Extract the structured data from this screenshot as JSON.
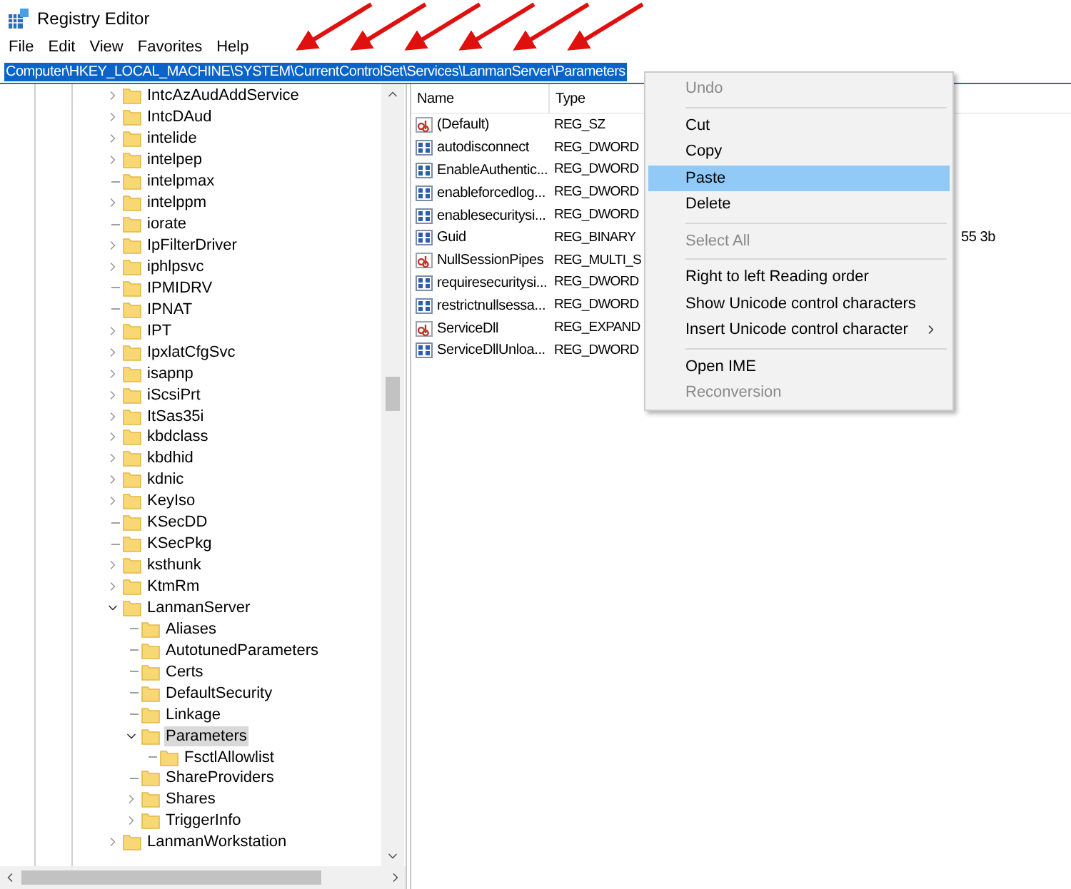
{
  "window": {
    "title": "Registry Editor"
  },
  "menu": [
    "File",
    "Edit",
    "View",
    "Favorites",
    "Help"
  ],
  "address": {
    "value": "Computer\\HKEY_LOCAL_MACHINE\\SYSTEM\\CurrentControlSet\\Services\\LanmanServer\\Parameters",
    "selected": true
  },
  "tree": [
    {
      "label": "IntcAzAudAddService",
      "expandable": true,
      "expanded": false,
      "selected": false
    },
    {
      "label": "IntcDAud",
      "expandable": true,
      "expanded": false,
      "selected": false
    },
    {
      "label": "intelide",
      "expandable": true,
      "expanded": false,
      "selected": false
    },
    {
      "label": "intelpep",
      "expandable": true,
      "expanded": false,
      "selected": false
    },
    {
      "label": "intelpmax",
      "expandable": false,
      "selected": false
    },
    {
      "label": "intelppm",
      "expandable": true,
      "expanded": false,
      "selected": false
    },
    {
      "label": "iorate",
      "expandable": false,
      "selected": false
    },
    {
      "label": "IpFilterDriver",
      "expandable": true,
      "expanded": false,
      "selected": false
    },
    {
      "label": "iphlpsvc",
      "expandable": true,
      "expanded": false,
      "selected": false
    },
    {
      "label": "IPMIDRV",
      "expandable": false,
      "selected": false
    },
    {
      "label": "IPNAT",
      "expandable": false,
      "selected": false
    },
    {
      "label": "IPT",
      "expandable": true,
      "expanded": false,
      "selected": false
    },
    {
      "label": "IpxlatCfgSvc",
      "expandable": true,
      "expanded": false,
      "selected": false
    },
    {
      "label": "isapnp",
      "expandable": true,
      "expanded": false,
      "selected": false
    },
    {
      "label": "iScsiPrt",
      "expandable": true,
      "expanded": false,
      "selected": false
    },
    {
      "label": "ItSas35i",
      "expandable": true,
      "expanded": false,
      "selected": false
    },
    {
      "label": "kbdclass",
      "expandable": true,
      "expanded": false,
      "selected": false
    },
    {
      "label": "kbdhid",
      "expandable": true,
      "expanded": false,
      "selected": false
    },
    {
      "label": "kdnic",
      "expandable": true,
      "expanded": false,
      "selected": false
    },
    {
      "label": "KeyIso",
      "expandable": true,
      "expanded": false,
      "selected": false
    },
    {
      "label": "KSecDD",
      "expandable": false,
      "selected": false
    },
    {
      "label": "KSecPkg",
      "expandable": false,
      "selected": false
    },
    {
      "label": "ksthunk",
      "expandable": true,
      "expanded": false,
      "selected": false
    },
    {
      "label": "KtmRm",
      "expandable": true,
      "expanded": false,
      "selected": false
    },
    {
      "label": "LanmanServer",
      "expandable": true,
      "expanded": true,
      "selected": false,
      "children": [
        {
          "label": "Aliases",
          "expandable": false,
          "selected": false
        },
        {
          "label": "AutotunedParameters",
          "expandable": false,
          "selected": false
        },
        {
          "label": "Certs",
          "expandable": false,
          "selected": false
        },
        {
          "label": "DefaultSecurity",
          "expandable": false,
          "selected": false
        },
        {
          "label": "Linkage",
          "expandable": false,
          "selected": false
        },
        {
          "label": "Parameters",
          "expandable": true,
          "expanded": true,
          "selected": true,
          "children": [
            {
              "label": "FsctlAllowlist",
              "expandable": false,
              "selected": false
            }
          ]
        },
        {
          "label": "ShareProviders",
          "expandable": false,
          "selected": false
        },
        {
          "label": "Shares",
          "expandable": true,
          "expanded": false,
          "selected": false
        },
        {
          "label": "TriggerInfo",
          "expandable": true,
          "expanded": false,
          "selected": false
        }
      ]
    },
    {
      "label": "LanmanWorkstation",
      "expandable": true,
      "expanded": false,
      "selected": false
    }
  ],
  "values_table": {
    "columns": [
      "Name",
      "Type"
    ],
    "rows": [
      {
        "kind": "string",
        "name": "(Default)",
        "type": "REG_SZ"
      },
      {
        "kind": "binary",
        "name": "autodisconnect",
        "type": "REG_DWORD"
      },
      {
        "kind": "binary",
        "name": "EnableAuthentic...",
        "type": "REG_DWORD"
      },
      {
        "kind": "binary",
        "name": "enableforcedlog...",
        "type": "REG_DWORD"
      },
      {
        "kind": "binary",
        "name": "enablesecuritysi...",
        "type": "REG_DWORD"
      },
      {
        "kind": "binary",
        "name": "Guid",
        "type": "REG_BINARY",
        "data": "55 3b"
      },
      {
        "kind": "string",
        "name": "NullSessionPipes",
        "type": "REG_MULTI_S"
      },
      {
        "kind": "binary",
        "name": "requiresecuritysi...",
        "type": "REG_DWORD"
      },
      {
        "kind": "binary",
        "name": "restrictnullsessa...",
        "type": "REG_DWORD"
      },
      {
        "kind": "string",
        "name": "ServiceDll",
        "type": "REG_EXPAND"
      },
      {
        "kind": "binary",
        "name": "ServiceDllUnloa...",
        "type": "REG_DWORD"
      }
    ]
  },
  "context_menu": [
    {
      "kind": "item",
      "label": "Undo",
      "disabled": true,
      "selected": false,
      "submenu": false
    },
    {
      "kind": "separator"
    },
    {
      "kind": "item",
      "label": "Cut",
      "disabled": false,
      "selected": false,
      "submenu": false
    },
    {
      "kind": "item",
      "label": "Copy",
      "disabled": false,
      "selected": false,
      "submenu": false
    },
    {
      "kind": "item",
      "label": "Paste",
      "disabled": false,
      "selected": true,
      "submenu": false
    },
    {
      "kind": "item",
      "label": "Delete",
      "disabled": false,
      "selected": false,
      "submenu": false
    },
    {
      "kind": "separator"
    },
    {
      "kind": "item",
      "label": "Select All",
      "disabled": true,
      "selected": false,
      "submenu": false
    },
    {
      "kind": "separator"
    },
    {
      "kind": "item",
      "label": "Right to left Reading order",
      "disabled": false,
      "selected": false,
      "submenu": false
    },
    {
      "kind": "item",
      "label": "Show Unicode control characters",
      "disabled": false,
      "selected": false,
      "submenu": false
    },
    {
      "kind": "item",
      "label": "Insert Unicode control character",
      "disabled": false,
      "selected": false,
      "submenu": true
    },
    {
      "kind": "separator"
    },
    {
      "kind": "item",
      "label": "Open IME",
      "disabled": false,
      "selected": false,
      "submenu": false
    },
    {
      "kind": "item",
      "label": "Reconversion",
      "disabled": true,
      "selected": false,
      "submenu": false
    }
  ]
}
